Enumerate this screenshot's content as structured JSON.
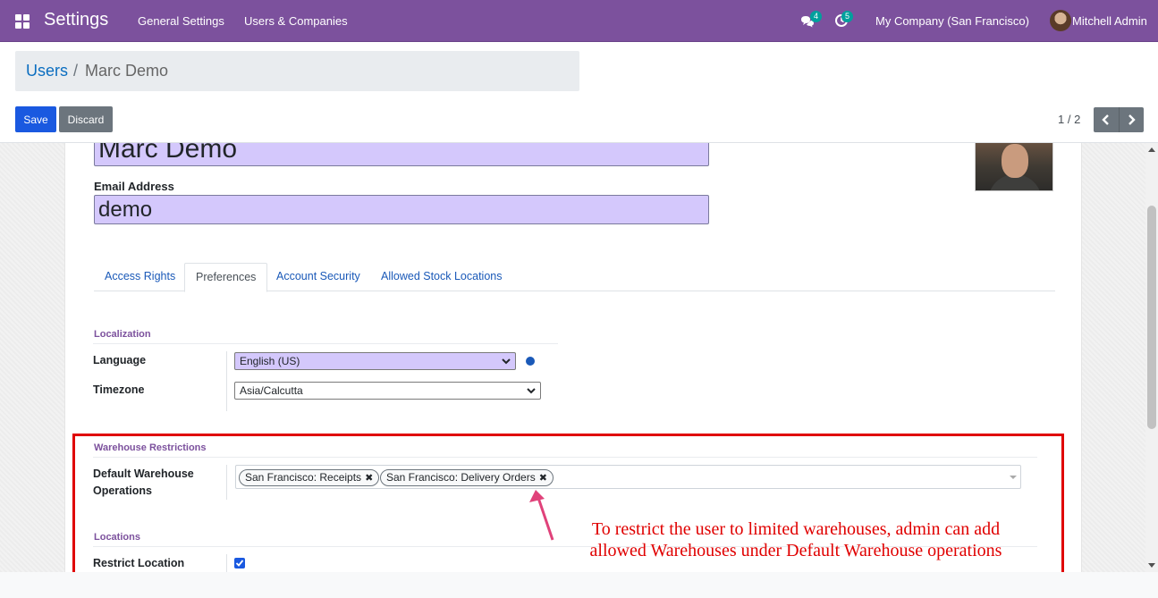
{
  "navbar": {
    "app_title": "Settings",
    "menu": [
      "General Settings",
      "Users & Companies"
    ],
    "chat_badge": "4",
    "activity_badge": "5",
    "company": "My Company (San Francisco)",
    "user": "Mitchell Admin",
    "bg_color": "#7c519d"
  },
  "breadcrumb": {
    "parent": "Users",
    "separator": "/",
    "current": "Marc Demo"
  },
  "toolbar": {
    "save_label": "Save",
    "discard_label": "Discard",
    "pager": "1 / 2"
  },
  "form": {
    "name": "Marc Demo",
    "email_label": "Email Address",
    "email_value": "demo"
  },
  "tabs": [
    {
      "label": "Access Rights",
      "active": false
    },
    {
      "label": "Preferences",
      "active": true
    },
    {
      "label": "Account Security",
      "active": false
    },
    {
      "label": "Allowed Stock Locations",
      "active": false
    }
  ],
  "localization": {
    "title": "Localization",
    "language_label": "Language",
    "language_value": "English (US)",
    "timezone_label": "Timezone",
    "timezone_value": "Asia/Calcutta"
  },
  "warehouse": {
    "title": "Warehouse Restrictions",
    "label_line1": "Default Warehouse",
    "label_line2": "Operations",
    "tags": [
      "San Francisco: Receipts",
      "San Francisco: Delivery Orders"
    ]
  },
  "locations": {
    "title": "Locations",
    "restrict_label": "Restrict Location",
    "restrict_checked": true
  },
  "annotation": {
    "line1": "To restrict the user to limited warehouses, admin can add",
    "line2": "allowed Warehouses under Default Warehouse operations",
    "color": "#e00000"
  }
}
